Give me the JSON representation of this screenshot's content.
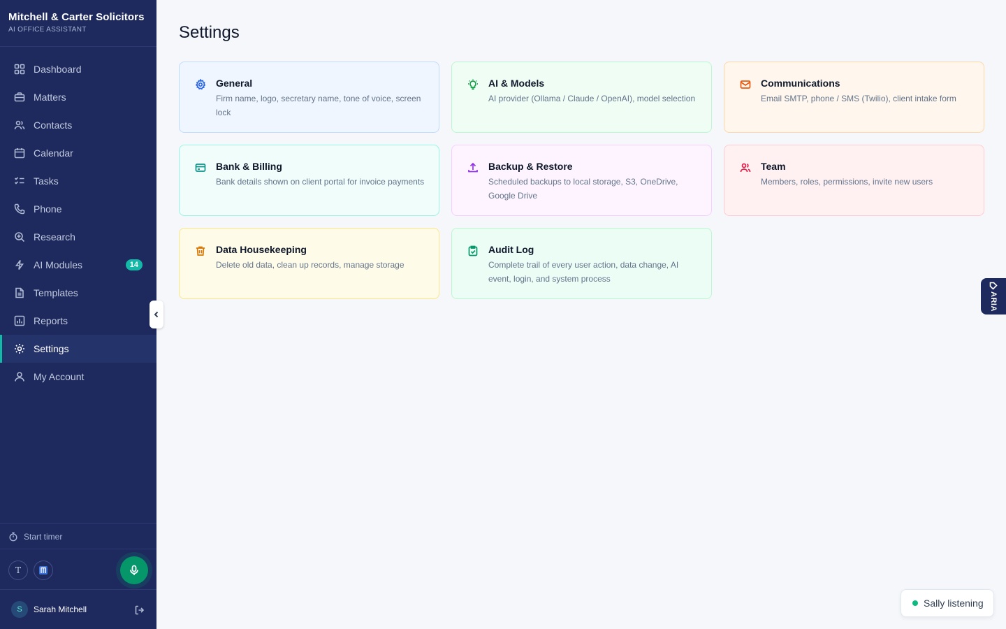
{
  "brand": {
    "name": "Mitchell & Carter Solicitors",
    "subtitle": "AI OFFICE ASSISTANT"
  },
  "sidebar": {
    "items": [
      {
        "label": "Dashboard",
        "icon": "grid-icon"
      },
      {
        "label": "Matters",
        "icon": "briefcase-icon"
      },
      {
        "label": "Contacts",
        "icon": "users-icon"
      },
      {
        "label": "Calendar",
        "icon": "calendar-icon"
      },
      {
        "label": "Tasks",
        "icon": "checklist-icon"
      },
      {
        "label": "Phone",
        "icon": "phone-icon"
      },
      {
        "label": "Research",
        "icon": "search-zoom-icon"
      },
      {
        "label": "AI Modules",
        "icon": "lightning-icon",
        "badge": "14"
      },
      {
        "label": "Templates",
        "icon": "document-icon"
      },
      {
        "label": "Reports",
        "icon": "bar-chart-icon"
      },
      {
        "label": "Settings",
        "icon": "gear-icon",
        "active": true
      },
      {
        "label": "My Account",
        "icon": "user-icon"
      }
    ],
    "timer_label": "Start timer",
    "tools": {
      "text_tool": "T"
    },
    "user": {
      "initial": "S",
      "name": "Sarah Mitchell"
    }
  },
  "main": {
    "title": "Settings",
    "cards": [
      {
        "title": "General",
        "desc": "Firm name, logo, secretary name, tone of voice, screen lock",
        "icon": "gear-icon",
        "accent": "#2563eb"
      },
      {
        "title": "AI & Models",
        "desc": "AI provider (Ollama / Claude / OpenAI), model selection",
        "icon": "lightbulb-icon",
        "accent": "#16a34a"
      },
      {
        "title": "Communications",
        "desc": "Email SMTP, phone / SMS (Twilio), client intake form",
        "icon": "mail-icon",
        "accent": "#ea580c"
      },
      {
        "title": "Bank & Billing",
        "desc": "Bank details shown on client portal for invoice payments",
        "icon": "credit-card-icon",
        "accent": "#0d9488"
      },
      {
        "title": "Backup & Restore",
        "desc": "Scheduled backups to local storage, S3, OneDrive, Google Drive",
        "icon": "upload-icon",
        "accent": "#9333ea"
      },
      {
        "title": "Team",
        "desc": "Members, roles, permissions, invite new users",
        "icon": "users-icon",
        "accent": "#e11d48"
      },
      {
        "title": "Data Housekeeping",
        "desc": "Delete old data, clean up records, manage storage",
        "icon": "trash-icon",
        "accent": "#d97706"
      },
      {
        "title": "Audit Log",
        "desc": "Complete trail of every user action, data change, AI event, login, and system process",
        "icon": "clipboard-check-icon",
        "accent": "#059669"
      }
    ]
  },
  "aria_tab": {
    "label": "ARIA"
  },
  "status": {
    "listening": "Sally listening"
  }
}
